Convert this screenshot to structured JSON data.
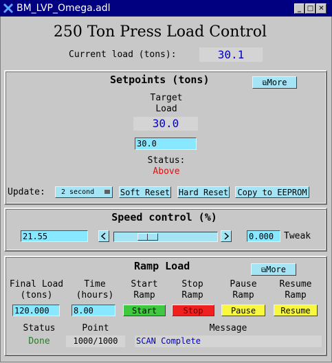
{
  "window": {
    "title": "BM_LVP_Omega.adl"
  },
  "header": {
    "title": "250 Ton Press Load Control",
    "current_load_label": "Current load (tons):",
    "current_load_value": "30.1"
  },
  "setpoints": {
    "title": "Setpoints (tons)",
    "more_label": "More",
    "target_label_1": "Target",
    "target_label_2": "Load",
    "target_value": "30.0",
    "target_input": "30.0",
    "status_label": "Status:",
    "status_value": "Above",
    "update_label": "Update:",
    "update_select": "2 second",
    "soft_reset": "Soft Reset",
    "hard_reset": "Hard Reset",
    "copy_eeprom": "Copy to EEPROM"
  },
  "speed": {
    "title": "Speed control (%)",
    "value_input": "21.55",
    "tweak_input": "0.000",
    "tweak_label": "Tweak",
    "slider_fraction": 0.28
  },
  "ramp": {
    "title": "Ramp Load",
    "more_label": "More",
    "final_load_label_1": "Final Load",
    "final_load_label_2": "(tons)",
    "time_label_1": "Time",
    "time_label_2": "(hours)",
    "start_label_1": "Start",
    "start_label_2": "Ramp",
    "stop_label_1": "Stop",
    "stop_label_2": "Ramp",
    "pause_label_1": "Pause",
    "pause_label_2": "Ramp",
    "resume_label_1": "Resume",
    "resume_label_2": "Ramp",
    "final_load_input": "120.000",
    "time_input": "8.00",
    "start_button": "Start",
    "stop_button": "Stop",
    "pause_button": "Pause",
    "resume_button": "Resume",
    "status_header": "Status",
    "point_header": "Point",
    "message_header": "Message",
    "status_value": "Done",
    "point_value": "1000/1000",
    "message_value": "SCAN Complete"
  },
  "colors": {
    "background": "#c8c8c8",
    "entry": "#88e8ff",
    "readback_text": "#0000c0",
    "alarm_text": "#e01010",
    "done_text": "#208020",
    "titlebar": "#000080"
  },
  "icons": {
    "app": "x-icon",
    "minimize": "minimize-icon",
    "maximize": "maximize-icon",
    "close": "close-icon",
    "more": "window-stack-icon"
  }
}
